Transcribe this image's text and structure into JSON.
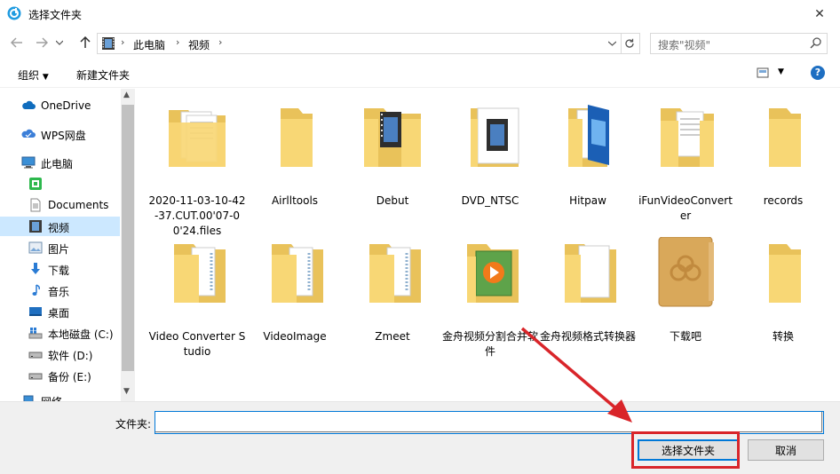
{
  "window": {
    "title": "选择文件夹",
    "close": "✕"
  },
  "nav": {
    "crumbs": [
      "此电脑",
      "视频"
    ],
    "search_placeholder": "搜索\"视频\""
  },
  "toolbar": {
    "organize": "组织",
    "new_folder": "新建文件夹"
  },
  "sidebar": {
    "items": [
      {
        "label": "OneDrive",
        "icon": "cloud-icon"
      },
      {
        "label": "WPS网盘",
        "icon": "wps-cloud-icon"
      },
      {
        "label": "此电脑",
        "icon": "computer-icon"
      },
      {
        "label": "",
        "icon": "green-app-icon"
      },
      {
        "label": "Documents",
        "icon": "document-icon"
      },
      {
        "label": "视频",
        "icon": "video-icon"
      },
      {
        "label": "图片",
        "icon": "pictures-icon"
      },
      {
        "label": "下载",
        "icon": "download-icon"
      },
      {
        "label": "音乐",
        "icon": "music-icon"
      },
      {
        "label": "桌面",
        "icon": "desktop-icon"
      },
      {
        "label": "本地磁盘 (C:)",
        "icon": "drive-c-icon"
      },
      {
        "label": "软件 (D:)",
        "icon": "drive-icon"
      },
      {
        "label": "备份 (E:)",
        "icon": "drive-icon"
      },
      {
        "label": "网络",
        "icon": "network-icon"
      }
    ]
  },
  "folders": [
    {
      "name": "2020-11-03-10-42-37.CUT.00'07-00'24.files",
      "icon": "folder-docs-icon"
    },
    {
      "name": "Airlltools",
      "icon": "folder-icon"
    },
    {
      "name": "Debut",
      "icon": "folder-video-icon"
    },
    {
      "name": "DVD_NTSC",
      "icon": "folder-video-icon"
    },
    {
      "name": "Hitpaw",
      "icon": "folder-windows-icon"
    },
    {
      "name": "iFunVideoConverter",
      "icon": "folder-docs-icon"
    },
    {
      "name": "records",
      "icon": "folder-icon"
    },
    {
      "name": "Video Converter Studio",
      "icon": "folder-docs-icon"
    },
    {
      "name": "VideoImage",
      "icon": "folder-docs-icon"
    },
    {
      "name": "Zmeet",
      "icon": "folder-docs-icon"
    },
    {
      "name": "金舟视频分割合并软件",
      "icon": "folder-play-icon"
    },
    {
      "name": "金舟视频格式转换器",
      "icon": "folder-white-icon"
    },
    {
      "name": "下载吧",
      "icon": "folder-special-icon"
    },
    {
      "name": "转换",
      "icon": "folder-icon"
    }
  ],
  "bottom": {
    "folder_label": "文件夹:",
    "folder_value": "",
    "select_button": "选择文件夹",
    "cancel_button": "取消"
  },
  "colors": {
    "accent": "#0078d7",
    "selection": "#cce8ff",
    "highlight": "#d9252a",
    "folder": "#f8d775"
  }
}
